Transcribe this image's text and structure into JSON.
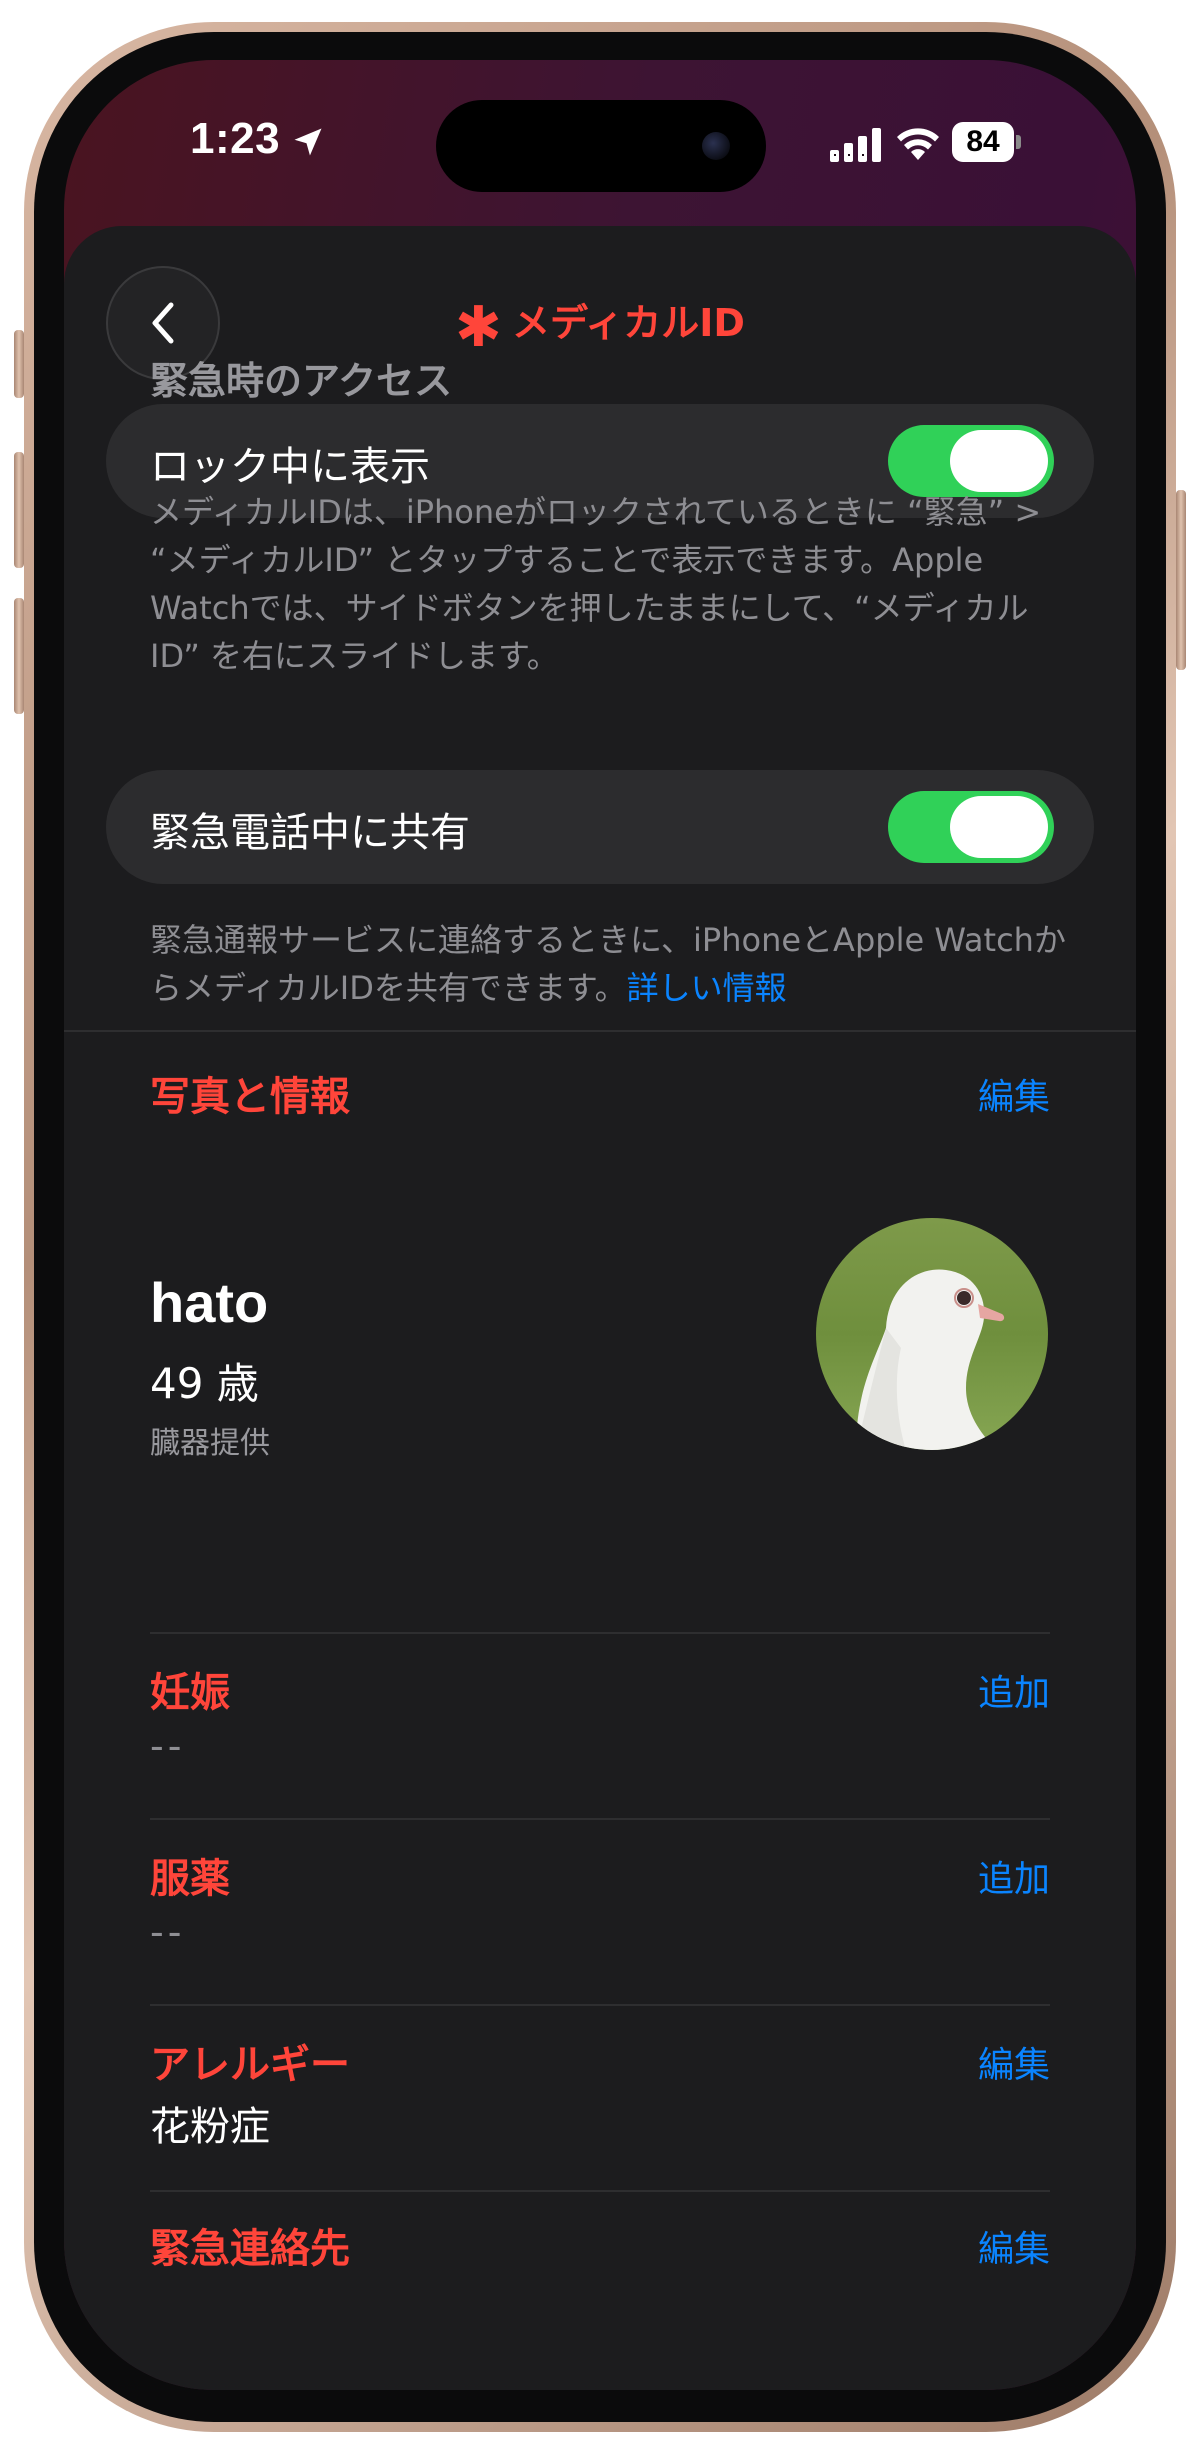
{
  "status_bar": {
    "time": "1:23",
    "battery": "84",
    "icons": [
      "location-arrow-icon",
      "signal-icon",
      "wifi-icon",
      "battery-icon"
    ]
  },
  "nav": {
    "title": "メディカルID",
    "title_icon": "✱",
    "back_icon": "chevron-left-icon"
  },
  "emergency_access": {
    "caption": "緊急時のアクセス",
    "show_when_locked": {
      "label": "ロック中に表示",
      "on": true,
      "footnote": "メディカルIDは、iPhoneがロックされているときに “緊急” > “メディカルID” とタップすることで表示できます。Apple Watchでは、サイドボタンを押したままにして、“メディカルID” を右にスライドします。"
    },
    "share_during_call": {
      "label": "緊急電話中に共有",
      "on": true,
      "footnote": "緊急通報サービスに連絡するときに、iPhoneとApple WatchからメディカルIDを共有できます。",
      "link": "詳しい情報"
    }
  },
  "profile_section": {
    "title": "写真と情報",
    "action": "編集",
    "name": "hato",
    "age": "49 歳",
    "donor": "臓器提供"
  },
  "sections": [
    {
      "title": "妊娠",
      "action": "追加",
      "value": "--"
    },
    {
      "title": "服薬",
      "action": "追加",
      "value": "--"
    },
    {
      "title": "アレルギー",
      "action": "編集",
      "value": "花粉症"
    },
    {
      "title": "緊急連絡先",
      "action": "編集",
      "value": ""
    }
  ],
  "colors": {
    "accent_red": "#ff453a",
    "link_blue": "#0a84ff",
    "toggle_green": "#30d158",
    "sheet_bg": "#1c1c1e"
  }
}
